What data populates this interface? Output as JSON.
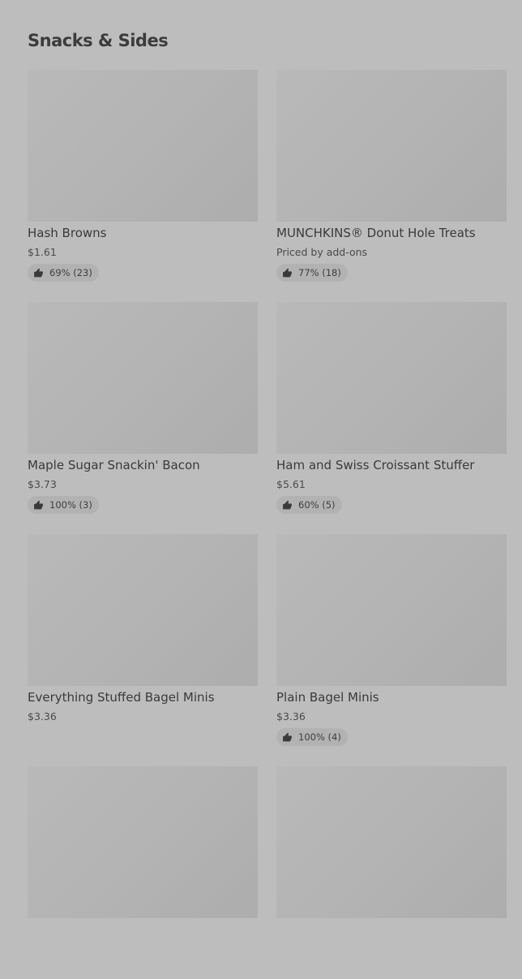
{
  "section": {
    "title": "Snacks & Sides"
  },
  "items": [
    {
      "name": "Hash Browns",
      "price": "$1.61",
      "rating": "69% (23)"
    },
    {
      "name": "MUNCHKINS® Donut Hole Treats",
      "price": "Priced by add-ons",
      "rating": "77% (18)"
    },
    {
      "name": "Maple Sugar Snackin' Bacon",
      "price": "$3.73",
      "rating": "100% (3)"
    },
    {
      "name": "Ham and Swiss Croissant Stuffer",
      "price": "$5.61",
      "rating": "60% (5)"
    },
    {
      "name": "Everything Stuffed Bagel Minis",
      "price": "$3.36"
    },
    {
      "name": "Plain Bagel Minis",
      "price": "$3.36",
      "rating": "100% (4)"
    },
    {},
    {}
  ],
  "icons": {
    "rating": "thumbs-up-icon"
  }
}
